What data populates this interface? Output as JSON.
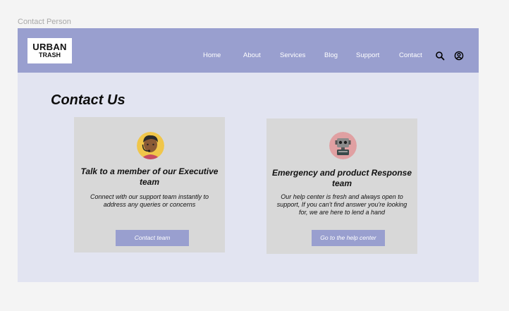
{
  "frame_label": "Contact Person",
  "logo": {
    "line1": "URBAN",
    "line2": "TRASH"
  },
  "nav": {
    "items": [
      {
        "label": "Home"
      },
      {
        "label": "About"
      },
      {
        "label": "Services"
      },
      {
        "label": "Blog"
      },
      {
        "label": "Support"
      },
      {
        "label": "Contact"
      }
    ],
    "icons": [
      "search-icon",
      "account-icon"
    ]
  },
  "page_title": "Contact Us",
  "cards": [
    {
      "title": "Talk to a member of our Executive team",
      "description": "Connect with our support team instantly to address any queries or concerns",
      "button": "Contact team",
      "avatar": "person-with-headset-avatar"
    },
    {
      "title": "Emergency and product Response team",
      "description": "Our help center is fresh and always open to support, If you can't find answer you're looking for, we are here to lend a hand",
      "button": "Go to the help center",
      "avatar": "robot-avatar"
    }
  ],
  "colors": {
    "navbar": "#999fcf",
    "frame_background": "#e2e4f1",
    "card": "#d8d8d8",
    "button": "#999fcf"
  }
}
